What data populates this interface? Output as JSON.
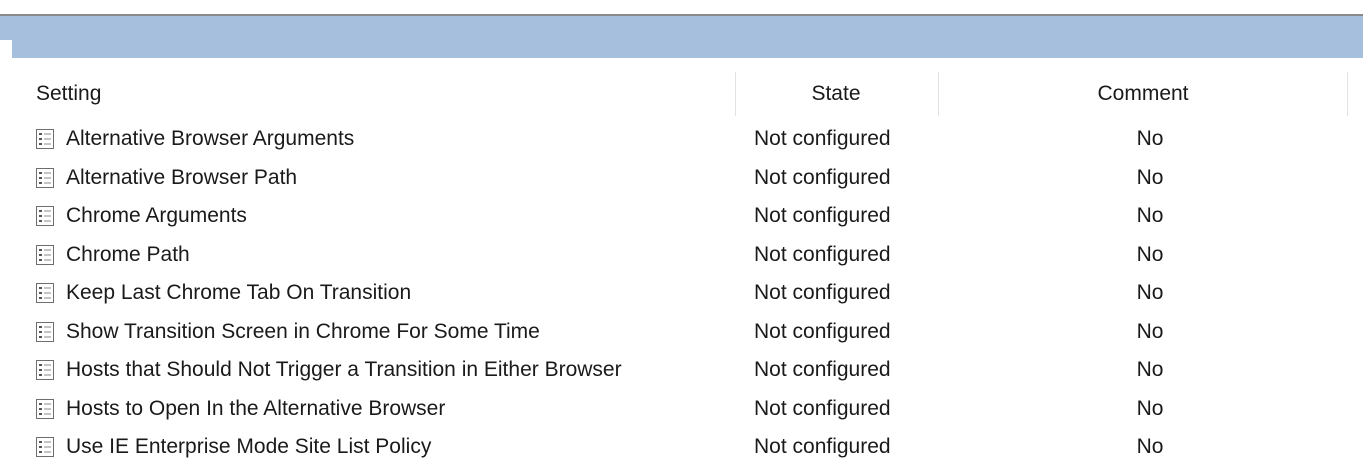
{
  "columns": {
    "setting": "Setting",
    "state": "State",
    "comment": "Comment"
  },
  "colors": {
    "title_band": "#a5bfdc",
    "text": "#1a1a1a"
  },
  "row_icon": "policy-setting-icon",
  "rows": [
    {
      "setting": "Alternative Browser Arguments",
      "state": "Not configured",
      "comment": "No"
    },
    {
      "setting": "Alternative Browser Path",
      "state": "Not configured",
      "comment": "No"
    },
    {
      "setting": "Chrome Arguments",
      "state": "Not configured",
      "comment": "No"
    },
    {
      "setting": "Chrome Path",
      "state": "Not configured",
      "comment": "No"
    },
    {
      "setting": "Keep Last Chrome Tab On Transition",
      "state": "Not configured",
      "comment": "No"
    },
    {
      "setting": "Show Transition Screen in Chrome For Some Time",
      "state": "Not configured",
      "comment": "No"
    },
    {
      "setting": "Hosts that Should Not Trigger a Transition in Either Browser",
      "state": "Not configured",
      "comment": "No"
    },
    {
      "setting": "Hosts to Open In the Alternative Browser",
      "state": "Not configured",
      "comment": "No"
    },
    {
      "setting": "Use IE Enterprise Mode Site List Policy",
      "state": "Not configured",
      "comment": "No"
    }
  ]
}
